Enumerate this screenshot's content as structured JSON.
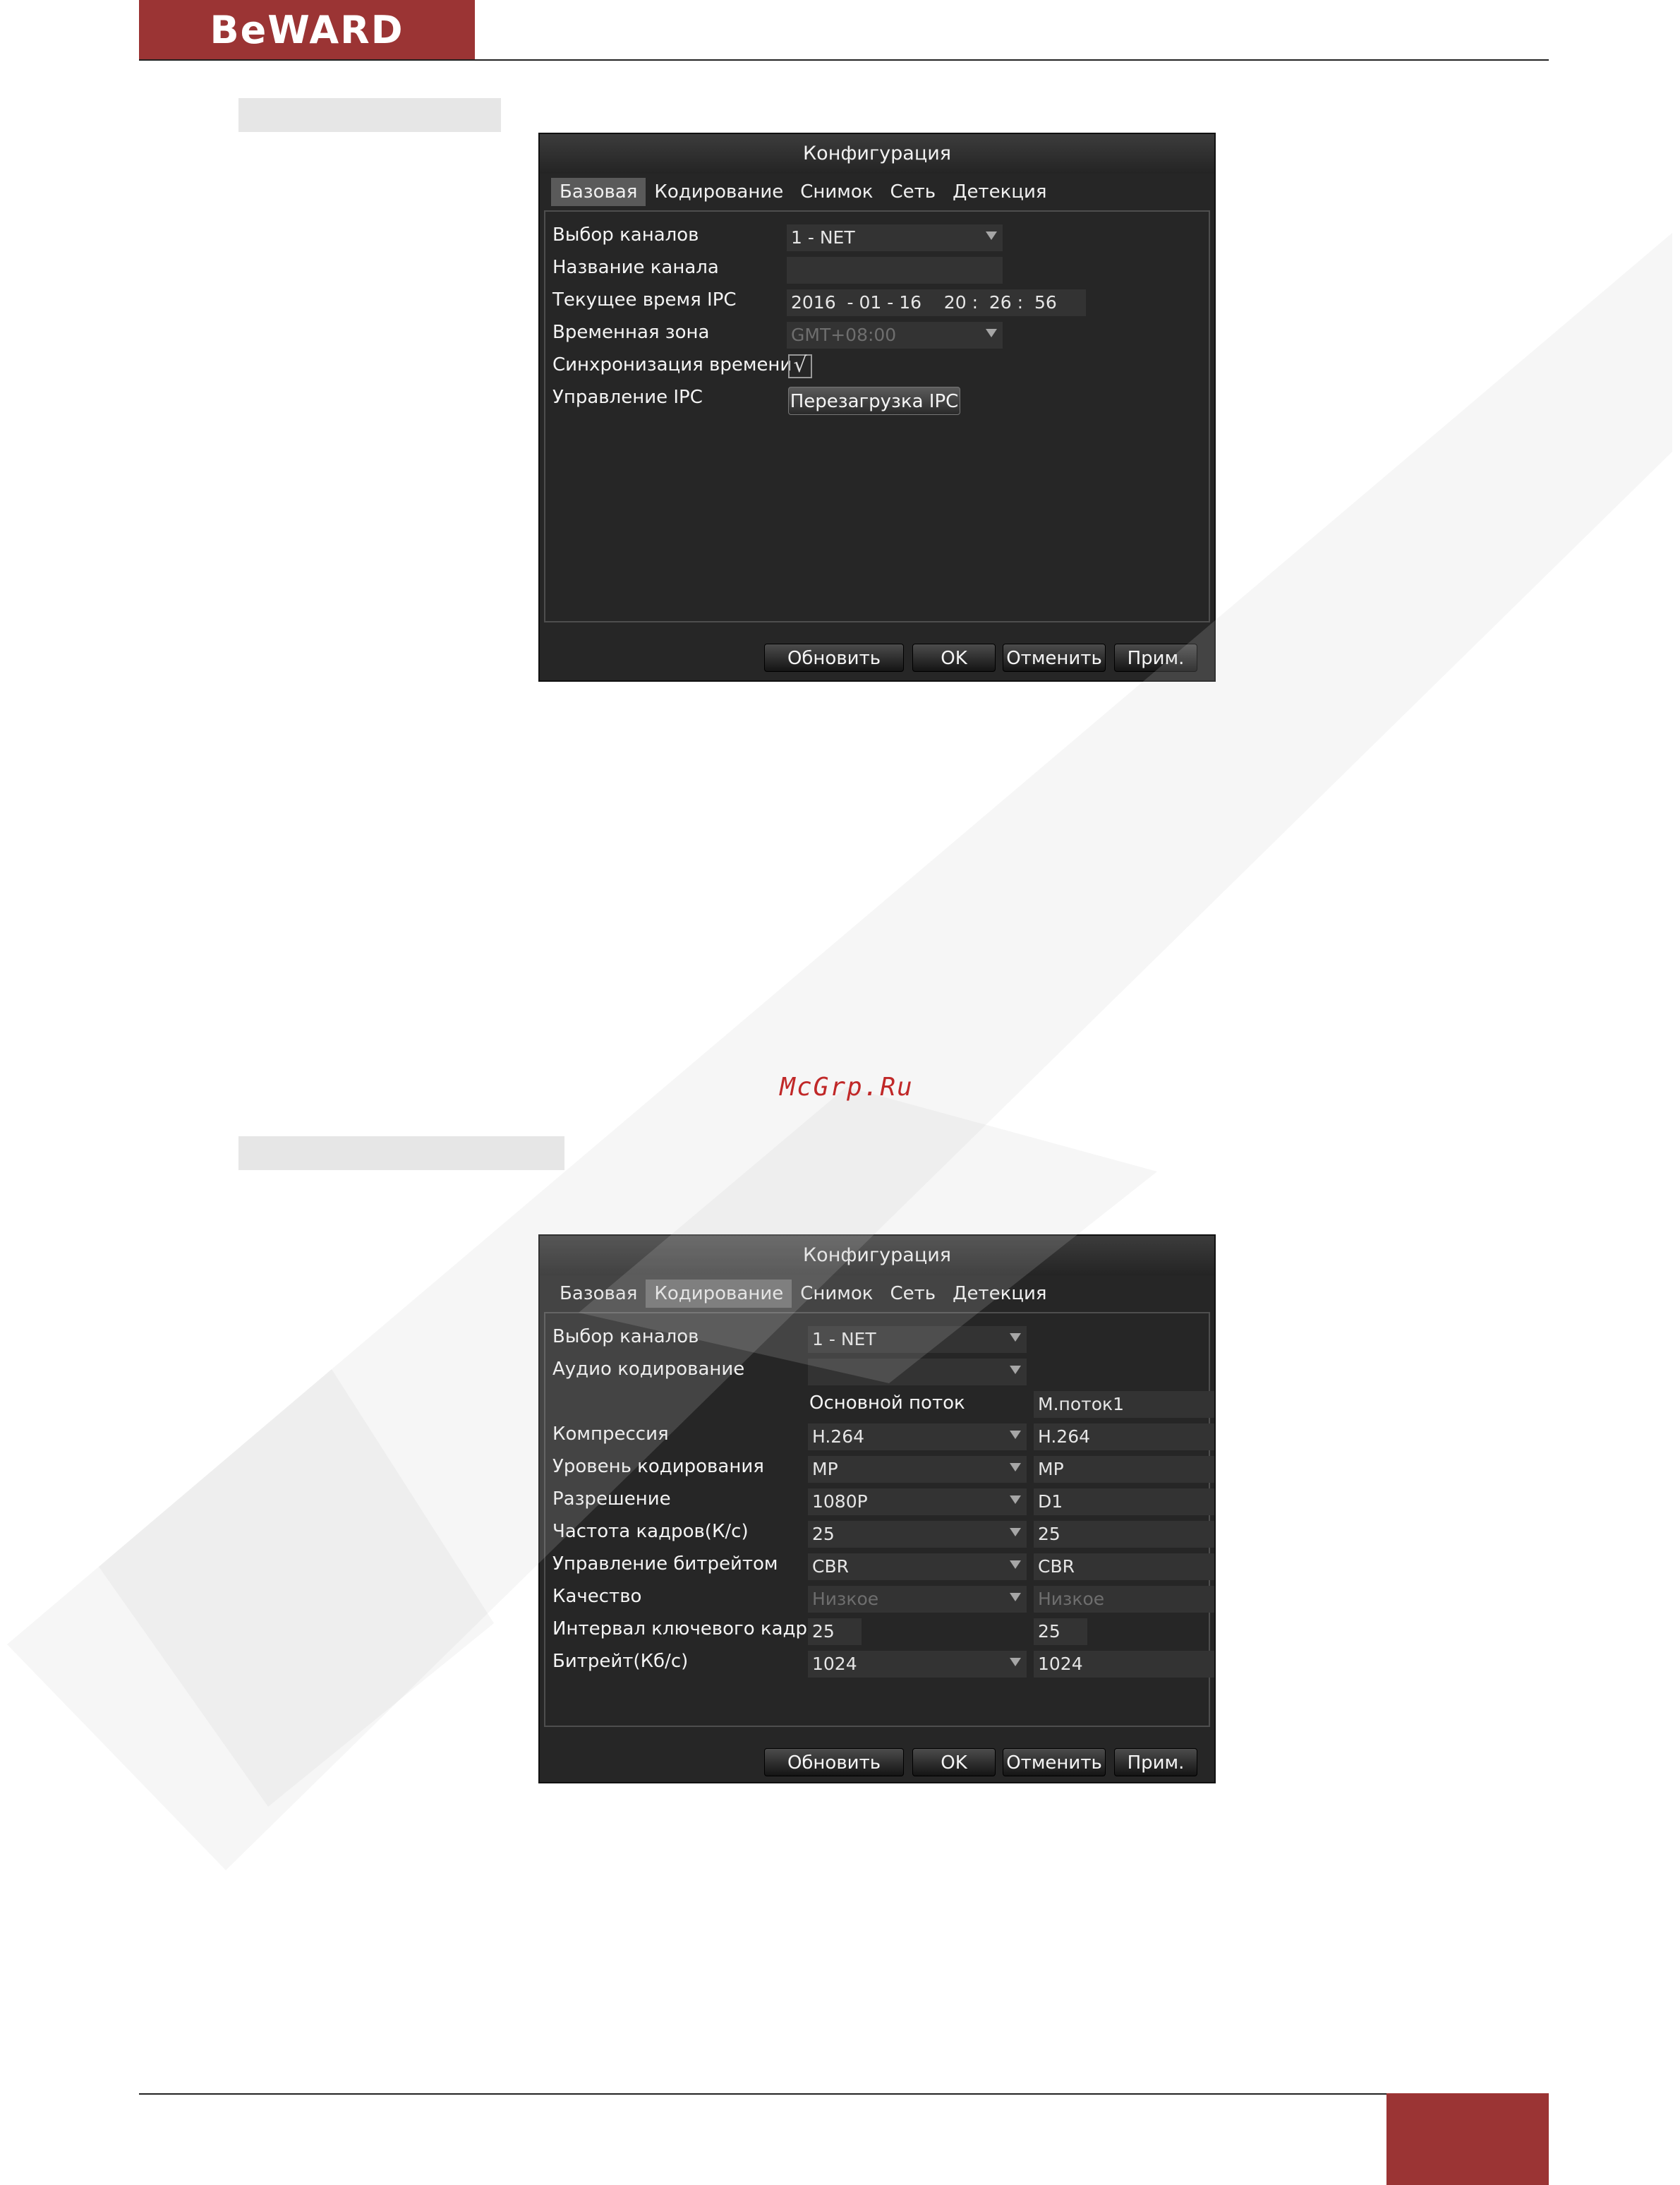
{
  "header": {
    "logo": "BeWARD"
  },
  "watermark_link": "McGrp.Ru",
  "dialog_basic": {
    "title": "Конфигурация",
    "tabs": [
      "Базовая",
      "Кодирование",
      "Снимок",
      "Сеть",
      "Детекция"
    ],
    "active_tab": "Базовая",
    "labels": {
      "channel": "Выбор каналов",
      "channel_name": "Название канала",
      "ipc_time": "Текущее время IPC",
      "timezone": "Временная зона",
      "time_sync": "Синхронизация времени",
      "ipc_control": "Управление IPC"
    },
    "values": {
      "channel": "1 - NET",
      "channel_name": "",
      "ipc_time": "2016  - 01 - 16    20 :  26 :  56",
      "timezone": "GMT+08:00",
      "time_sync_checked": true,
      "time_sync_mark": "√"
    },
    "reboot_button": "Перезагрузка IPC",
    "buttons": {
      "refresh": "Обновить",
      "ok": "OK",
      "cancel": "Отменить",
      "apply": "Прим."
    }
  },
  "dialog_encoding": {
    "title": "Конфигурация",
    "tabs": [
      "Базовая",
      "Кодирование",
      "Снимок",
      "Сеть",
      "Детекция"
    ],
    "active_tab": "Кодирование",
    "labels": {
      "channel": "Выбор каналов",
      "audio": "Аудио кодирование",
      "compression": "Компрессия",
      "level": "Уровень кодирования",
      "resolution": "Разрешение",
      "fps": "Частота кадров(К/с)",
      "bitrate_control": "Управление битрейтом",
      "quality": "Качество",
      "gop": "Интервал ключевого кадра",
      "bitrate": "Битрейт(Кб/с)"
    },
    "channel_value": "1 - NET",
    "audio_value": "",
    "main_stream": {
      "header": "Основной поток",
      "compression": "H.264",
      "level": "MP",
      "resolution": "1080P",
      "fps": "25",
      "bitrate_control": "CBR",
      "quality": "Низкое",
      "gop": "25",
      "bitrate": "1024"
    },
    "sub_stream": {
      "header": "М.поток1",
      "compression": "H.264",
      "level": "MP",
      "resolution": "D1",
      "fps": "25",
      "bitrate_control": "CBR",
      "quality": "Низкое",
      "gop": "25",
      "bitrate": "1024"
    },
    "buttons": {
      "refresh": "Обновить",
      "ok": "OK",
      "cancel": "Отменить",
      "apply": "Прим."
    }
  },
  "colors": {
    "brand": "#9b3434",
    "dialog_bg": "#262626",
    "field_bg": "#333333"
  }
}
